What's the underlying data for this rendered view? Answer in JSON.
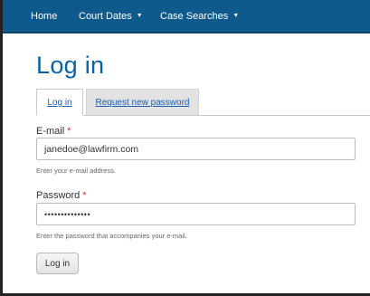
{
  "navbar": {
    "items": [
      {
        "label": "Home"
      },
      {
        "label": "Court Dates",
        "dropdown": true
      },
      {
        "label": "Case Searches",
        "dropdown": true
      }
    ],
    "background_color": "#0f5a8c"
  },
  "page": {
    "title": "Log in",
    "title_color": "#0a62a6"
  },
  "tabs": [
    {
      "label": "Log in",
      "active": true
    },
    {
      "label": "Request new password",
      "active": false
    }
  ],
  "form": {
    "email": {
      "label": "E-mail",
      "required_mark": "*",
      "value": "janedoe@lawfirm.com",
      "help": "Enter your e-mail address."
    },
    "password": {
      "label": "Password",
      "required_mark": "*",
      "value": "••••••••••••••",
      "help": "Enter the password that accompanies your e-mail."
    },
    "submit_label": "Log in"
  },
  "icons": {
    "dropdown": "caret-down-icon"
  }
}
